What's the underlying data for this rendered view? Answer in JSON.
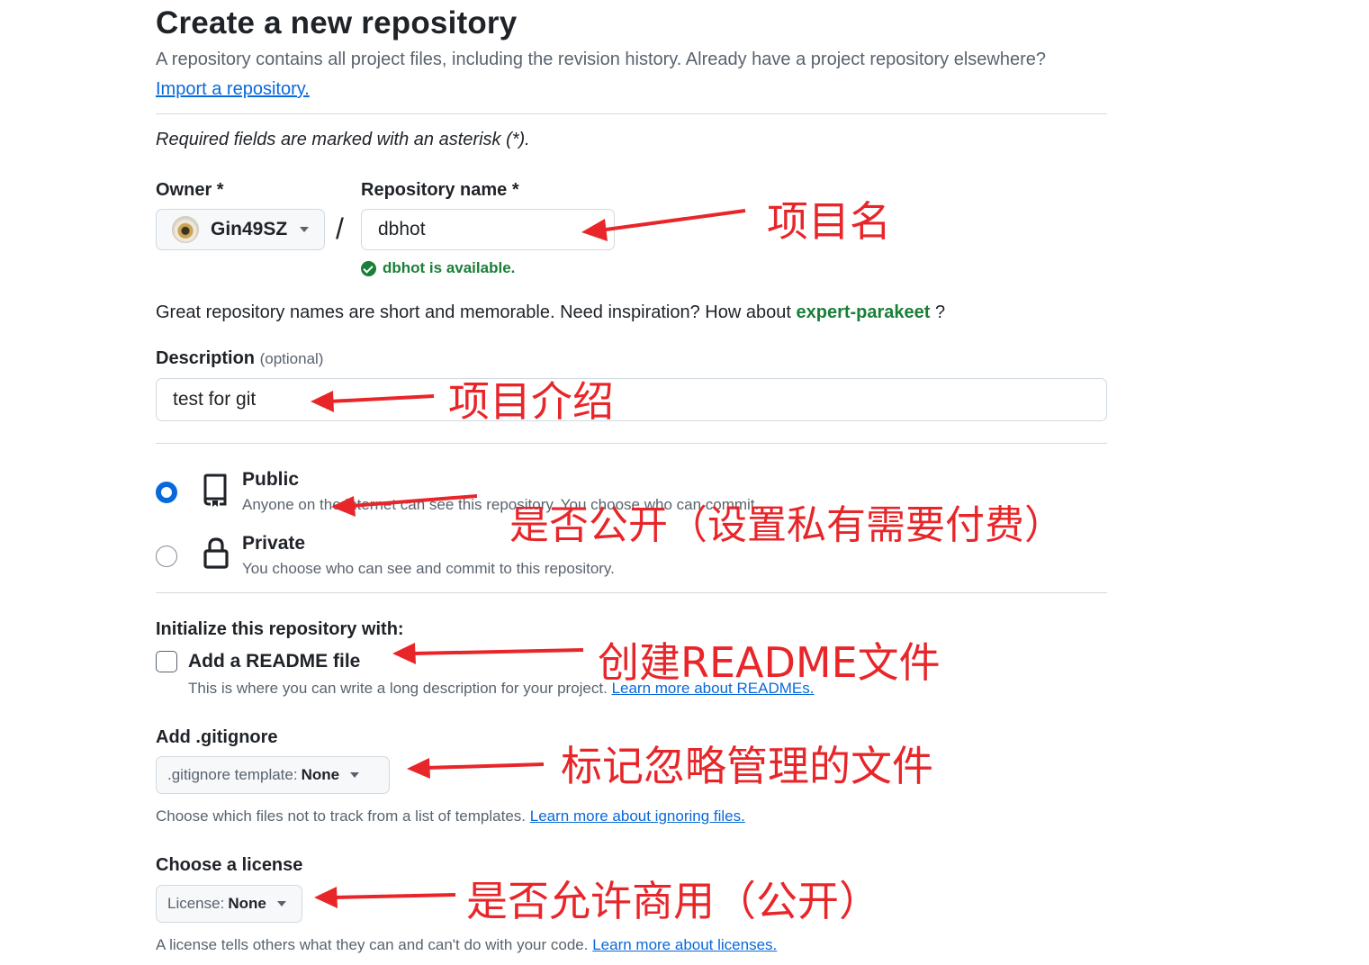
{
  "header": {
    "title": "Create a new repository",
    "subtitle": "A repository contains all project files, including the revision history. Already have a project repository elsewhere?",
    "import_link": "Import a repository."
  },
  "required_note": "Required fields are marked with an asterisk (*).",
  "owner": {
    "label": "Owner *",
    "value": "Gin49SZ"
  },
  "repo_name": {
    "label": "Repository name *",
    "value": "dbhot",
    "availability": "dbhot is available."
  },
  "slash": "/",
  "inspiration": {
    "text": "Great repository names are short and memorable. Need inspiration? How about",
    "suggestion": "expert-parakeet",
    "suffix": "?"
  },
  "description": {
    "label": "Description",
    "optional": "(optional)",
    "value": "test for git"
  },
  "visibility": {
    "public": {
      "title": "Public",
      "desc": "Anyone on the internet can see this repository. You choose who can commit.",
      "selected": true
    },
    "private": {
      "title": "Private",
      "desc": "You choose who can see and commit to this repository.",
      "selected": false
    }
  },
  "initialize": {
    "heading": "Initialize this repository with:",
    "readme_label": "Add a README file",
    "readme_checked": false,
    "readme_desc": "This is where you can write a long description for your project.",
    "readme_link": "Learn more about READMEs."
  },
  "gitignore": {
    "label": "Add .gitignore",
    "select_prefix": ".gitignore template:",
    "select_value": "None",
    "note": "Choose which files not to track from a list of templates.",
    "note_link": "Learn more about ignoring files."
  },
  "license": {
    "label": "Choose a license",
    "select_prefix": "License:",
    "select_value": "None",
    "note": "A license tells others what they can and can't do with your code.",
    "note_link": "Learn more about licenses."
  },
  "annotations": {
    "repo_name": "项目名",
    "description": "项目介绍",
    "visibility": "是否公开（设置私有需要付费）",
    "readme": "创建README文件",
    "gitignore": "标记忽略管理的文件",
    "license": "是否允许商用（公开）"
  },
  "colors": {
    "annotation_red": "#e8262a",
    "link_blue": "#0969da",
    "success_green": "#1a7f37"
  }
}
